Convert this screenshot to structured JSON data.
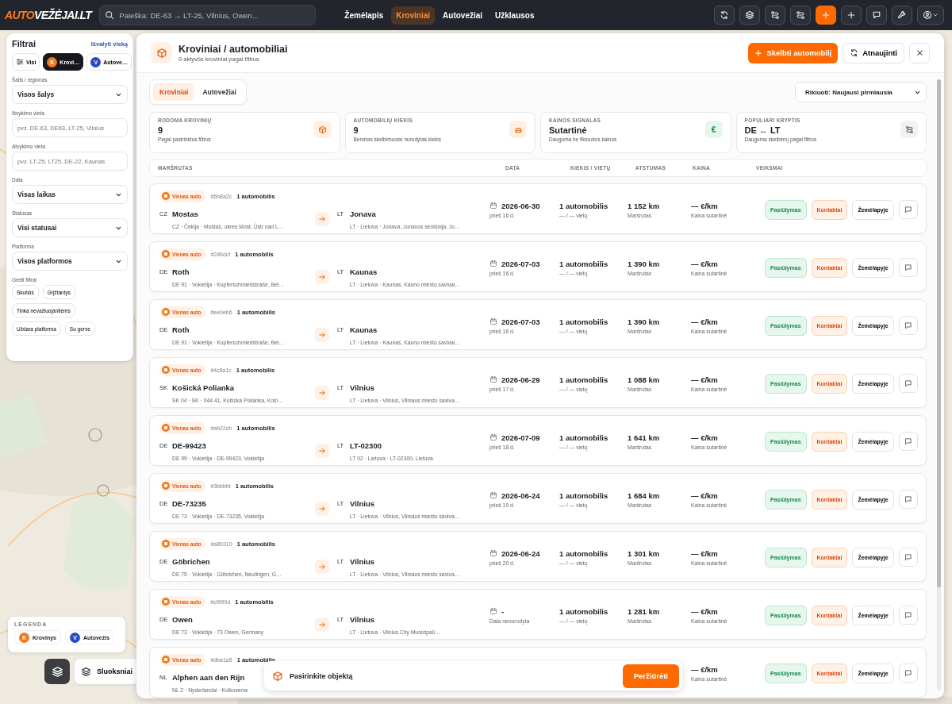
{
  "topbar": {
    "logo": {
      "accent": "AUTO",
      "rest": "VEŽĖJAI.LT"
    },
    "search": {
      "placeholder": "Paieška: DE-63 → LT-25, Vilnius, Owen..."
    },
    "nav": [
      {
        "label": "Žemėlapis",
        "selected": false
      },
      {
        "label": "Kroviniai",
        "selected": true
      },
      {
        "label": "Autovežiai",
        "selected": false
      },
      {
        "label": "Užklausos",
        "selected": false
      }
    ]
  },
  "filters": {
    "title": "Filtrai",
    "clear": "Išvalyti viską",
    "types": [
      {
        "label": "Visi",
        "kind": "all",
        "selected": false
      },
      {
        "label": "Krovi…",
        "kind": "cargo",
        "mark": "K",
        "selected": true
      },
      {
        "label": "Autove…",
        "kind": "carrier",
        "mark": "V",
        "selected": false
      }
    ],
    "fields": [
      {
        "label": "Šalis / regionas",
        "kind": "select",
        "value": "Visos šalys"
      },
      {
        "label": "Išvykimo vieta",
        "kind": "input",
        "placeholder": "pvz. DE-63, DE63, LT-25, Vilnius"
      },
      {
        "label": "Atvykimo vieta",
        "kind": "input",
        "placeholder": "pvz. LT-25, LT25, DE-22, Kaunas"
      },
      {
        "label": "Data",
        "kind": "select",
        "value": "Visas laikas"
      },
      {
        "label": "Statusas",
        "kind": "select",
        "value": "Visi statusai"
      },
      {
        "label": "Platforma",
        "kind": "select",
        "value": "Visos platformos"
      }
    ],
    "quick_title": "Greiti filtrai",
    "quick": [
      "Skubūs",
      "Grįžtantys",
      "Tinka nevažiuojantiems",
      "Uždara platforma",
      "Su gerve"
    ]
  },
  "legend": {
    "title": "LEGENDA",
    "items": [
      {
        "mark": "K",
        "label": "Krovinys",
        "kind": "cargo"
      },
      {
        "mark": "V",
        "label": "Autovežis",
        "kind": "carrier"
      }
    ]
  },
  "layers": {
    "label": "Sluoksniai"
  },
  "panel": {
    "title": "Kroviniai / automobiliai",
    "subtitle": "9 aktyvūs kroviniai pagal filtrus",
    "post_button": "Skelbti automobilį",
    "refresh_button": "Atnaujinti",
    "tabs": [
      {
        "label": "Kroviniai",
        "selected": true
      },
      {
        "label": "Autovežiai",
        "selected": false
      }
    ],
    "sort": "Rikiuoti: Naujausi pirmiausia",
    "stats": [
      {
        "label": "RODOMA KROVINIŲ",
        "value": "9",
        "note": "Pagal pasirinktus filtrus",
        "kind": "box"
      },
      {
        "label": "AUTOMOBILIŲ KIEKIS",
        "value": "9",
        "note": "Bendras skelbimuose nurodytas kiekis",
        "kind": "car"
      },
      {
        "label": "KAINOS SIGNALAS",
        "value": "Sutartinė",
        "note": "Dauguma be fiksuotos kainos",
        "kind": "euro",
        "symbol": "€"
      },
      {
        "label": "POPULIARI KRYPTIS",
        "value": "DE ↔ LT",
        "note": "Dauguma skelbimų pagal filtrus",
        "kind": "route"
      }
    ],
    "columns": [
      "MARŠRUTAS",
      "DATA",
      "KIEKIS / VIETŲ",
      "ATSTUMAS",
      "KAINA",
      "VEIKSMAI"
    ],
    "rows": [
      {
        "badge": "Vienas auto",
        "ref": "#6b8a2c",
        "count": "1 automobilis",
        "from": {
          "code": "CZ",
          "name": "Mostas",
          "address": "CZ · Čekija · Mostas, okres Most, Ústí nad L…"
        },
        "to": {
          "code": "LT",
          "name": "Jonava",
          "address": "LT · Lietuva · Jonava, Jonavos seniūnija, Jo…"
        },
        "date": {
          "value": "2026-06-30",
          "note": "prieš 16 d."
        },
        "quantity": {
          "value": "1 automobilis",
          "note": "— / — vietų"
        },
        "distance": {
          "value": "1 152 km",
          "note": "Maršrutas"
        },
        "price": {
          "value": "— €/km",
          "note": "Kaina sutartinė"
        },
        "actions": [
          {
            "label": "Pasiūlymas",
            "kind": "offer"
          },
          {
            "label": "Kontaktai",
            "kind": "contact"
          },
          {
            "label": "Žemėlapyje",
            "kind": "map"
          }
        ]
      },
      {
        "badge": "Vienas auto",
        "ref": "#246dcf",
        "count": "1 automobilis",
        "from": {
          "code": "DE",
          "name": "Roth",
          "address": "DE 91 · Vokietija · Kupferschmiedstraße, Bel…"
        },
        "to": {
          "code": "LT",
          "name": "Kaunas",
          "address": "LT · Lietuva · Kaunas, Kauno miesto savival…"
        },
        "date": {
          "value": "2026-07-03",
          "note": "prieš 16 d."
        },
        "quantity": {
          "value": "1 automobilis",
          "note": "— / — vietų"
        },
        "distance": {
          "value": "1 390 km",
          "note": "Maršrutas"
        },
        "price": {
          "value": "— €/km",
          "note": "Kaina sutartinė"
        },
        "actions": [
          {
            "label": "Pasiūlymas",
            "kind": "offer"
          },
          {
            "label": "Kontaktai",
            "kind": "contact"
          },
          {
            "label": "Žemėlapyje",
            "kind": "map"
          }
        ]
      },
      {
        "badge": "Vienas auto",
        "ref": "#ee0eb6",
        "count": "1 automobilis",
        "from": {
          "code": "DE",
          "name": "Roth",
          "address": "DE 91 · Vokietija · Kupferschmiedstraße, Bel…"
        },
        "to": {
          "code": "LT",
          "name": "Kaunas",
          "address": "LT · Lietuva · Kaunas, Kauno miesto savival…"
        },
        "date": {
          "value": "2026-07-03",
          "note": "prieš 16 d."
        },
        "quantity": {
          "value": "1 automobilis",
          "note": "— / — vietų"
        },
        "distance": {
          "value": "1 390 km",
          "note": "Maršrutas"
        },
        "price": {
          "value": "— €/km",
          "note": "Kaina sutartinė"
        },
        "actions": [
          {
            "label": "Pasiūlymas",
            "kind": "offer"
          },
          {
            "label": "Kontaktai",
            "kind": "contact"
          },
          {
            "label": "Žemėlapyje",
            "kind": "map"
          }
        ]
      },
      {
        "badge": "Vienas auto",
        "ref": "#4c8a1c",
        "count": "1 automobilis",
        "from": {
          "code": "SK",
          "name": "Košická Polianka",
          "address": "SK 04 · SK · 044 41, Košická Polianka, Koši…"
        },
        "to": {
          "code": "LT",
          "name": "Vilnius",
          "address": "LT · Lietuva · Vilnius, Vilniaus miesto saviva…"
        },
        "date": {
          "value": "2026-06-29",
          "note": "prieš 17 d."
        },
        "quantity": {
          "value": "1 automobilis",
          "note": "— / — vietų"
        },
        "distance": {
          "value": "1 088 km",
          "note": "Maršrutas"
        },
        "price": {
          "value": "— €/km",
          "note": "Kaina sutartinė"
        },
        "actions": [
          {
            "label": "Pasiūlymas",
            "kind": "offer"
          },
          {
            "label": "Kontaktai",
            "kind": "contact"
          },
          {
            "label": "Žemėlapyje",
            "kind": "map"
          }
        ]
      },
      {
        "badge": "Vienas auto",
        "ref": "#ab22cb",
        "count": "1 automobilis",
        "from": {
          "code": "DE",
          "name": "DE-99423",
          "address": "DE 99 · Vokietija · DE-99423, Vokietija"
        },
        "to": {
          "code": "LT",
          "name": "LT-02300",
          "address": "LT 02 · Lietuva · LT-02300, Lietuva"
        },
        "date": {
          "value": "2026-07-09",
          "note": "prieš 18 d."
        },
        "quantity": {
          "value": "1 automobilis",
          "note": "— / — vietų"
        },
        "distance": {
          "value": "1 641 km",
          "note": "Maršrutas"
        },
        "price": {
          "value": "— €/km",
          "note": "Kaina sutartinė"
        },
        "actions": [
          {
            "label": "Pasiūlymas",
            "kind": "offer"
          },
          {
            "label": "Kontaktai",
            "kind": "contact"
          },
          {
            "label": "Žemėlapyje",
            "kind": "map"
          }
        ]
      },
      {
        "badge": "Vienas auto",
        "ref": "#3bbbfd",
        "count": "1 automobilis",
        "from": {
          "code": "DE",
          "name": "DE-73235",
          "address": "DE 73 · Vokietija · DE-73235, Vokietija"
        },
        "to": {
          "code": "LT",
          "name": "Vilnius",
          "address": "LT · Lietuva · Vilnius, Vilniaus miesto saviva…"
        },
        "date": {
          "value": "2026-06-24",
          "note": "prieš 19 d."
        },
        "quantity": {
          "value": "1 automobilis",
          "note": "— / — vietų"
        },
        "distance": {
          "value": "1 684 km",
          "note": "Maršrutas"
        },
        "price": {
          "value": "— €/km",
          "note": "Kaina sutartinė"
        },
        "actions": [
          {
            "label": "Pasiūlymas",
            "kind": "offer"
          },
          {
            "label": "Kontaktai",
            "kind": "contact"
          },
          {
            "label": "Žemėlapyje",
            "kind": "map"
          }
        ]
      },
      {
        "badge": "Vienas auto",
        "ref": "#a80310",
        "count": "1 automobilis",
        "from": {
          "code": "DE",
          "name": "Göbrichen",
          "address": "DE 75 · Vokietija · Göbrichen, Neulingen, G…"
        },
        "to": {
          "code": "LT",
          "name": "Vilnius",
          "address": "LT · Lietuva · Vilnius, Vilniaus miesto saviva…"
        },
        "date": {
          "value": "2026-06-24",
          "note": "prieš 20 d."
        },
        "quantity": {
          "value": "1 automobilis",
          "note": "— / — vietų"
        },
        "distance": {
          "value": "1 301 km",
          "note": "Maršrutas"
        },
        "price": {
          "value": "— €/km",
          "note": "Kaina sutartinė"
        },
        "actions": [
          {
            "label": "Pasiūlymas",
            "kind": "offer"
          },
          {
            "label": "Kontaktai",
            "kind": "contact"
          },
          {
            "label": "Žemėlapyje",
            "kind": "map"
          }
        ]
      },
      {
        "badge": "Vienas auto",
        "ref": "#cf990d",
        "count": "1 automobilis",
        "from": {
          "code": "DE",
          "name": "Owen",
          "address": "DE 73 · Vokietija · 73 Owen, Germany"
        },
        "to": {
          "code": "LT",
          "name": "Vilnius",
          "address": "LT · Lietuva · Vilnius City Municipali…"
        },
        "date": {
          "value": "-",
          "note": "Data nenurodyta"
        },
        "quantity": {
          "value": "1 automobilis",
          "note": "— / — vietų"
        },
        "distance": {
          "value": "1 281 km",
          "note": "Maršrutas"
        },
        "price": {
          "value": "— €/km",
          "note": "Kaina sutartinė"
        },
        "actions": [
          {
            "label": "Pasiūlymas",
            "kind": "offer"
          },
          {
            "label": "Kontaktai",
            "kind": "contact"
          },
          {
            "label": "Žemėlapyje",
            "kind": "map"
          }
        ]
      },
      {
        "badge": "Vienas auto",
        "ref": "#dba1a5",
        "count": "1 automobilis",
        "from": {
          "code": "NL",
          "name": "Alphen aan den Rijn",
          "address": "NL 2 · Nyderlandai · Kolkovenw"
        },
        "price": {
          "value": "— €/km",
          "note": "Kaina sutartinė"
        },
        "actions": [
          {
            "label": "Pasiūlymas",
            "kind": "offer"
          },
          {
            "label": "Kontaktai",
            "kind": "contact"
          },
          {
            "label": "Žemėlapyje",
            "kind": "map"
          }
        ]
      }
    ],
    "selection": {
      "text": "Pasirinkite objektą",
      "button": "Peržiūrėti"
    }
  }
}
